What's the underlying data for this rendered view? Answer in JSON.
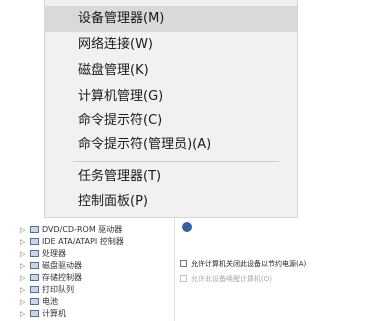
{
  "menu": {
    "items": [
      {
        "label": "设备管理器(M)",
        "highlighted": true
      },
      {
        "label": "网络连接(W)"
      },
      {
        "label": "磁盘管理(K)"
      },
      {
        "label": "计算机管理(G)"
      },
      {
        "label": "命令提示符(C)"
      },
      {
        "label": "命令提示符(管理员)(A)"
      },
      {
        "label": "任务管理器(T)"
      },
      {
        "label": "控制面板(P)"
      }
    ],
    "highlight_color": "#d9d9d9"
  },
  "device_tree": {
    "rows": [
      {
        "label": "DVD/CD-ROM 驱动器",
        "icon": "dvd-drive-icon"
      },
      {
        "label": "IDE ATA/ATAPI 控制器",
        "icon": "ide-controller-icon"
      },
      {
        "label": "处理器",
        "icon": "processor-icon"
      },
      {
        "label": "磁盘驱动器",
        "icon": "disk-drive-icon"
      },
      {
        "label": "存储控制器",
        "icon": "storage-controller-icon"
      },
      {
        "label": "打印队列",
        "icon": "print-queue-icon"
      },
      {
        "label": "电池",
        "icon": "battery-icon"
      },
      {
        "label": "计算机",
        "icon": "computer-icon"
      }
    ]
  },
  "power_panel": {
    "options": [
      {
        "label": "允许计算机关闭此设备以节约电源(A)",
        "checked": false,
        "enabled": true
      },
      {
        "label": "允许此设备唤醒计算机(O)",
        "checked": false,
        "enabled": false
      }
    ]
  }
}
